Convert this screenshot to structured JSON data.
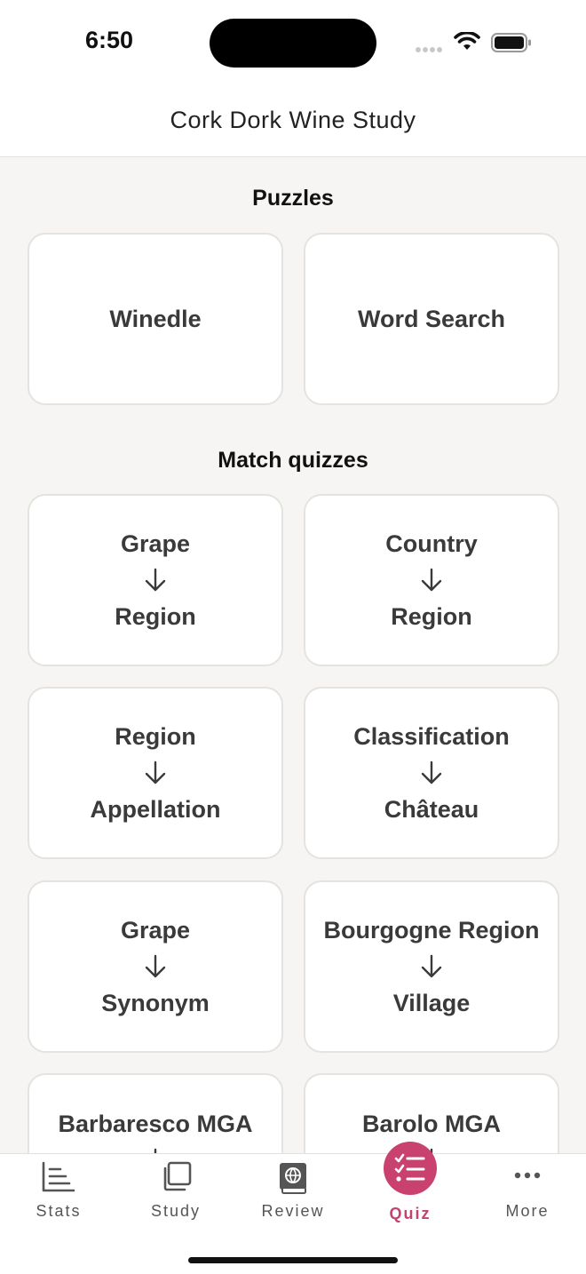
{
  "status": {
    "time": "6:50"
  },
  "header": {
    "title": "Cork Dork Wine Study"
  },
  "puzzles": {
    "title": "Puzzles",
    "items": [
      "Winedle",
      "Word Search"
    ]
  },
  "match": {
    "title": "Match quizzes",
    "items": [
      {
        "from": "Grape",
        "to": "Region"
      },
      {
        "from": "Country",
        "to": "Region"
      },
      {
        "from": "Region",
        "to": "Appellation"
      },
      {
        "from": "Classification",
        "to": "Château"
      },
      {
        "from": "Grape",
        "to": "Synonym"
      },
      {
        "from": "Bourgogne Region",
        "to": "Village"
      },
      {
        "from": "Barbaresco MGA",
        "to": ""
      },
      {
        "from": "Barolo MGA",
        "to": ""
      }
    ]
  },
  "tabs": [
    {
      "label": "Stats",
      "icon": "stats-icon"
    },
    {
      "label": "Study",
      "icon": "study-icon"
    },
    {
      "label": "Review",
      "icon": "review-icon"
    },
    {
      "label": "Quiz",
      "icon": "quiz-icon"
    },
    {
      "label": "More",
      "icon": "more-icon"
    }
  ],
  "colors": {
    "accent": "#c9426f",
    "background": "#f6f5f3",
    "card": "#ffffff"
  }
}
